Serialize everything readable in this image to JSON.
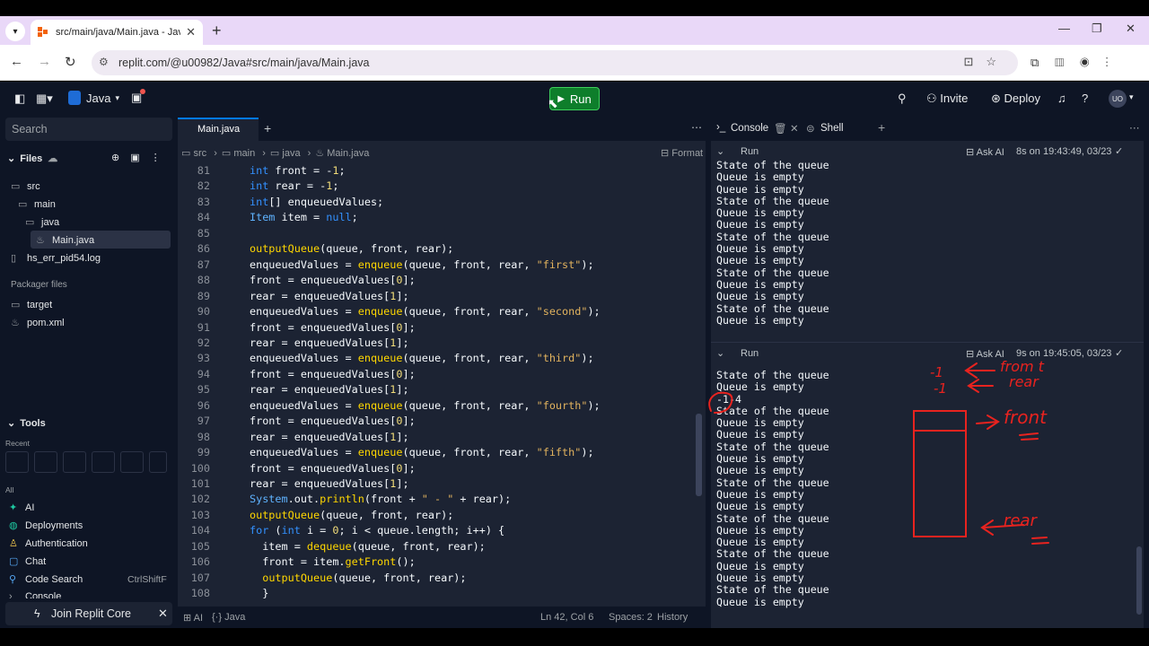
{
  "browser": {
    "tab_title": "src/main/java/Main.java - Java",
    "url": "replit.com/@u00982/Java#src/main/java/Main.java"
  },
  "topbar": {
    "project": "Java",
    "run": "Run",
    "invite": "Invite",
    "deploy": "Deploy",
    "avatar": "UO"
  },
  "sidebar": {
    "search_placeholder": "Search",
    "files_title": "Files",
    "tree": [
      "src",
      "main",
      "java",
      "Main.java",
      "hs_err_pid54.log"
    ],
    "packager_title": "Packager files",
    "packager": [
      "target",
      "pom.xml"
    ],
    "tools_title": "Tools",
    "recent": "Recent",
    "all": "All",
    "tools": [
      "AI",
      "Deployments",
      "Authentication",
      "Chat",
      "Code Search",
      "Console"
    ],
    "code_search_shortcut": "CtrlShiftF",
    "join": "Join Replit Core"
  },
  "editor": {
    "tab": "Main.java",
    "breadcrumb": [
      "src",
      "main",
      "java",
      "Main.java"
    ],
    "format": "Format",
    "status": {
      "ai": "AI",
      "lang": "Java",
      "pos": "Ln 42, Col 6",
      "spaces": "Spaces: 2",
      "history": "History"
    }
  },
  "code_lines": [
    {
      "n": "81",
      "text": "int front = -1;"
    },
    {
      "n": "82",
      "text": "int rear = -1;"
    },
    {
      "n": "83",
      "text": "int[] enqueuedValues;"
    },
    {
      "n": "84",
      "text": "Item item = null;"
    },
    {
      "n": "85",
      "text": ""
    },
    {
      "n": "86",
      "text": "outputQueue(queue, front, rear);"
    },
    {
      "n": "87",
      "text": "enqueuedValues = enqueue(queue, front, rear, \"first\");"
    },
    {
      "n": "88",
      "text": "front = enqueuedValues[0];"
    },
    {
      "n": "89",
      "text": "rear = enqueuedValues[1];"
    },
    {
      "n": "90",
      "text": "enqueuedValues = enqueue(queue, front, rear, \"second\");"
    },
    {
      "n": "91",
      "text": "front = enqueuedValues[0];"
    },
    {
      "n": "92",
      "text": "rear = enqueuedValues[1];"
    },
    {
      "n": "93",
      "text": "enqueuedValues = enqueue(queue, front, rear, \"third\");"
    },
    {
      "n": "94",
      "text": "front = enqueuedValues[0];"
    },
    {
      "n": "95",
      "text": "rear = enqueuedValues[1];"
    },
    {
      "n": "96",
      "text": "enqueuedValues = enqueue(queue, front, rear, \"fourth\");"
    },
    {
      "n": "97",
      "text": "front = enqueuedValues[0];"
    },
    {
      "n": "98",
      "text": "rear = enqueuedValues[1];"
    },
    {
      "n": "99",
      "text": "enqueuedValues = enqueue(queue, front, rear, \"fifth\");"
    },
    {
      "n": "100",
      "text": "front = enqueuedValues[0];"
    },
    {
      "n": "101",
      "text": "rear = enqueuedValues[1];"
    },
    {
      "n": "102",
      "text": "System.out.println(front + \" - \" + rear);"
    },
    {
      "n": "103",
      "text": "outputQueue(queue, front, rear);"
    },
    {
      "n": "104",
      "text": "for (int i = 0; i < queue.length; i++) {"
    },
    {
      "n": "105",
      "text": "  item = dequeue(queue, front, rear);"
    },
    {
      "n": "106",
      "text": "  front = item.getFront();"
    },
    {
      "n": "107",
      "text": "  outputQueue(queue, front, rear);"
    },
    {
      "n": "108",
      "text": "  }"
    }
  ],
  "console": {
    "tab": "Console",
    "shell": "Shell",
    "run1": {
      "title": "Run",
      "ask": "Ask AI",
      "time": "8s on 19:43:49, 03/23",
      "lines": [
        "State of the queue",
        "Queue is empty",
        "Queue is empty",
        "State of the queue",
        "Queue is empty",
        "Queue is empty",
        "State of the queue",
        "Queue is empty",
        "Queue is empty",
        "State of the queue",
        "Queue is empty",
        "Queue is empty",
        "State of the queue",
        "Queue is empty"
      ]
    },
    "run2": {
      "title": "Run",
      "ask": "Ask AI",
      "time": "9s on 19:45:05, 03/23",
      "lines": [
        "State of the queue",
        "Queue is empty",
        "-1-4",
        "State of the queue",
        "Queue is empty",
        "Queue is empty",
        "State of the queue",
        "Queue is empty",
        "Queue is empty",
        "State of the queue",
        "Queue is empty",
        "Queue is empty",
        "State of the queue",
        "Queue is empty",
        "Queue is empty",
        "State of the queue",
        "Queue is empty",
        "Queue is empty",
        "State of the queue",
        "Queue is empty"
      ]
    }
  },
  "annotation_text": {
    "vals": "-1\n-1",
    "front_rear": "from t\nrear",
    "front": "front",
    "rear": "rear"
  }
}
